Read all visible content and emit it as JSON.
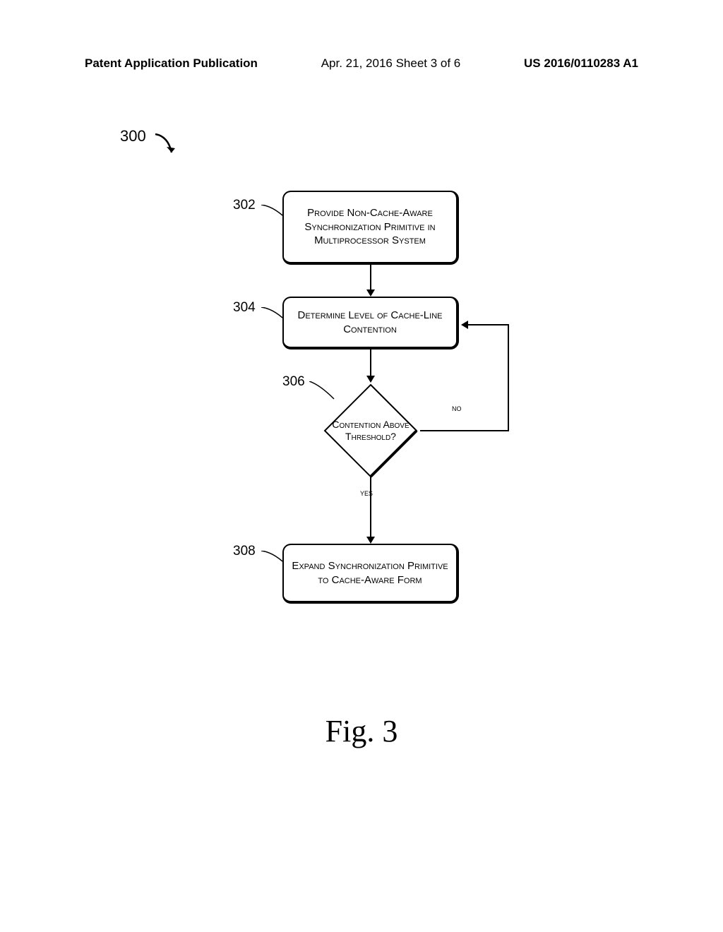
{
  "header": {
    "left": "Patent Application Publication",
    "center": "Apr. 21, 2016  Sheet 3 of 6",
    "right": "US 2016/0110283 A1"
  },
  "refMain": "300",
  "labels": {
    "l302": "302",
    "l304": "304",
    "l306": "306",
    "l308": "308"
  },
  "boxes": {
    "b302": "Provide Non-Cache-Aware Synchronization Primitive in Multiprocessor System",
    "b304": "Determine Level of Cache-Line Contention",
    "b306": "Contention Above Threshold?",
    "b308": "Expand Synchronization Primitive to Cache-Aware Form"
  },
  "edges": {
    "yes": "yes",
    "no": "no"
  },
  "figure": "Fig.  3"
}
